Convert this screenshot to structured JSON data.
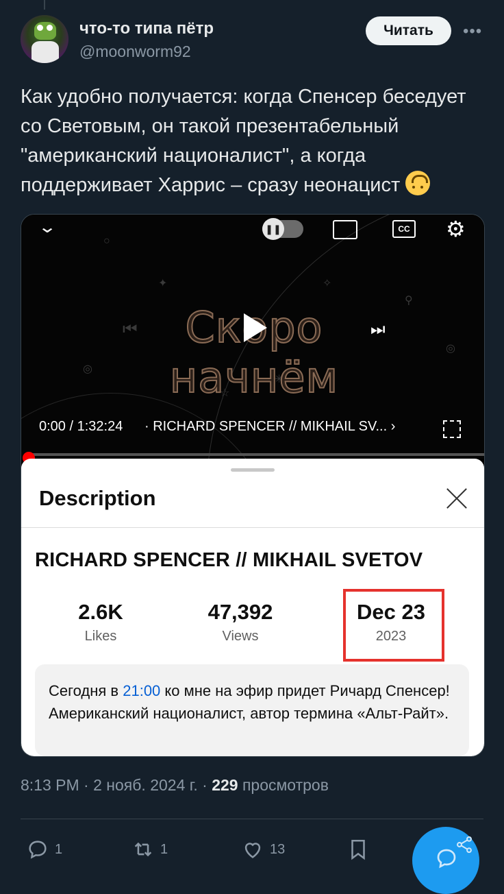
{
  "author": {
    "name": "что-то типа пётр",
    "handle": "@moonworm92",
    "follow_label": "Читать",
    "more_label": "•••"
  },
  "tweet": {
    "text": "Как удобно получается: когда Спенсер беседует со Световым, он такой презентабельный \"американский националист\", а когда поддерживает Харрис – сразу неонацист",
    "emoji": "upside-down-face-icon"
  },
  "video": {
    "overlay_text": "Скоро начнём",
    "time": "0:00 / 1:32:24",
    "title": "· RICHARD SPENCER // MIKHAIL SV... ›",
    "cc_label": "CC",
    "progress_percent": 0
  },
  "description_sheet": {
    "heading": "Description",
    "video_title": "RICHARD SPENCER // MIKHAIL SVETOV",
    "stats": [
      {
        "value": "2.6K",
        "label": "Likes"
      },
      {
        "value": "47,392",
        "label": "Views"
      },
      {
        "value": "Dec 23",
        "label": "2023"
      }
    ],
    "body_before": "Сегодня в ",
    "body_link": "21:00",
    "body_after": " ко мне на эфир придет Ричард Спенсер! Американский националист, автор термина «Альт-Райт».",
    "highlight_color": "#e5322d"
  },
  "meta": {
    "time": "8:13 PM",
    "date": "2 нояб. 2024 г.",
    "views_count": "229",
    "views_label": "просмотров"
  },
  "actions": {
    "replies": "1",
    "reposts": "1",
    "likes": "13"
  },
  "colors": {
    "background": "#15202b",
    "accent": "#1d9bf0",
    "muted": "#8b98a5"
  }
}
